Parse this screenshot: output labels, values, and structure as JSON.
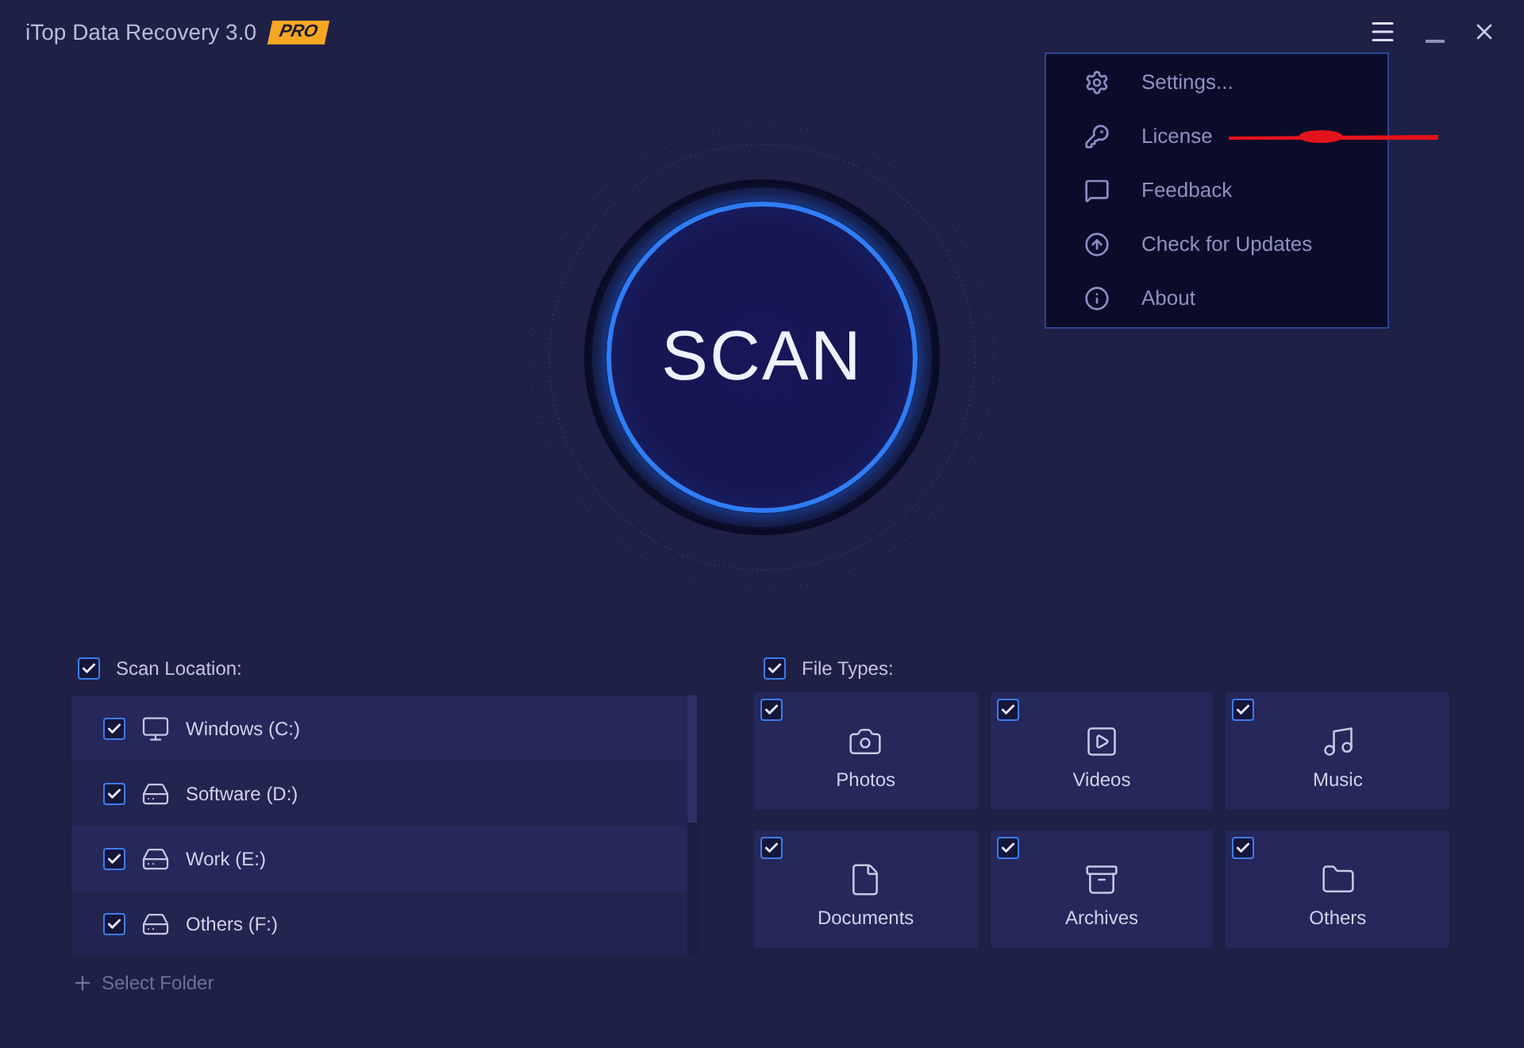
{
  "window": {
    "title": "iTop Data Recovery 3.0",
    "badge": "PRO"
  },
  "menu": {
    "items": [
      {
        "label": "Settings...",
        "kind": "settings"
      },
      {
        "label": "License",
        "kind": "license"
      },
      {
        "label": "Feedback",
        "kind": "feedback"
      },
      {
        "label": "Check for Updates",
        "kind": "update"
      },
      {
        "label": "About",
        "kind": "about"
      }
    ]
  },
  "scan_button": "SCAN",
  "scan_location": {
    "label": "Scan Location:",
    "checked": true,
    "drives": [
      {
        "label": "Windows (C:)",
        "kind": "system",
        "checked": true
      },
      {
        "label": "Software (D:)",
        "kind": "drive",
        "checked": true
      },
      {
        "label": "Work (E:)",
        "kind": "drive",
        "checked": true
      },
      {
        "label": "Others (F:)",
        "kind": "drive",
        "checked": true
      }
    ],
    "select_folder": "Select Folder"
  },
  "file_types": {
    "label": "File Types:",
    "checked": true,
    "items": [
      {
        "label": "Photos",
        "kind": "photo",
        "checked": true
      },
      {
        "label": "Videos",
        "kind": "video",
        "checked": true
      },
      {
        "label": "Music",
        "kind": "music",
        "checked": true
      },
      {
        "label": "Documents",
        "kind": "document",
        "checked": true
      },
      {
        "label": "Archives",
        "kind": "archive",
        "checked": true
      },
      {
        "label": "Others",
        "kind": "other",
        "checked": true
      }
    ]
  }
}
